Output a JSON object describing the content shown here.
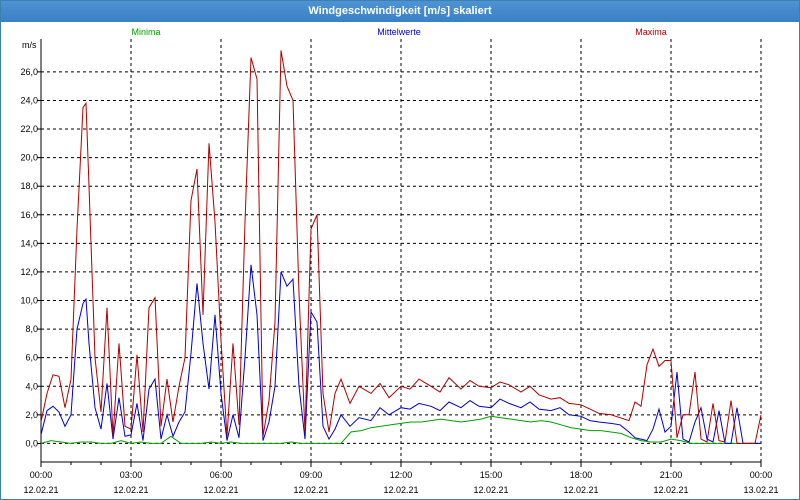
{
  "window": {
    "title": "Windgeschwindigkeit [m/s] skaliert"
  },
  "chart_data": {
    "type": "line",
    "title": "Windgeschwindigkeit [m/s] skaliert",
    "ylabel": "m/s",
    "xlabel": "",
    "ylim": [
      -1.3,
      28.3
    ],
    "xlim": [
      0,
      24
    ],
    "y_ticks": [
      0,
      2,
      4,
      6,
      8,
      10,
      12,
      14,
      16,
      18,
      20,
      22,
      24,
      26
    ],
    "y_tick_labels": [
      "0,0",
      "2,0",
      "4,0",
      "6,0",
      "8,0",
      "10,0",
      "12,0",
      "14,0",
      "16,0",
      "18,0",
      "20,0",
      "22,0",
      "24,0",
      "26,0"
    ],
    "x_ticks": [
      0,
      3,
      6,
      9,
      12,
      15,
      18,
      21,
      24
    ],
    "x_tick_time_labels": [
      "00:00",
      "03:00",
      "06:00",
      "09:00",
      "12:00",
      "15:00",
      "18:00",
      "21:00",
      "00:00"
    ],
    "x_tick_date_labels": [
      "12.02.21",
      "12.02.21",
      "12.02.21",
      "12.02.21",
      "12.02.21",
      "12.02.21",
      "12.02.21",
      "12.02.21",
      "13.02.21"
    ],
    "grid": true,
    "legend_placement": "top",
    "series": [
      {
        "name": "Minima",
        "color": "#00a000",
        "x": [
          0,
          0.33,
          0.67,
          1,
          1.33,
          1.67,
          2,
          2.33,
          2.67,
          3,
          3.33,
          3.67,
          4,
          4.33,
          4.67,
          5,
          5.33,
          5.67,
          6,
          6.33,
          6.67,
          7,
          7.33,
          7.67,
          8,
          8.33,
          8.67,
          9,
          9.33,
          9.67,
          10,
          10.33,
          10.67,
          11,
          11.33,
          11.67,
          12,
          12.33,
          12.67,
          13,
          13.33,
          13.67,
          14,
          14.33,
          14.67,
          15,
          15.33,
          15.67,
          16,
          16.33,
          16.67,
          17,
          17.33,
          17.67,
          18,
          18.33,
          18.67,
          19,
          19.33,
          19.67,
          20,
          20.33,
          20.67,
          21,
          21.33,
          21.67,
          22,
          22.33,
          22.67,
          23,
          23.33,
          23.67,
          24
        ],
        "values": [
          0,
          0.2,
          0.1,
          0,
          0.1,
          0.1,
          0,
          0,
          0.2,
          0,
          0.1,
          0,
          0,
          0.5,
          0,
          0,
          0,
          0.1,
          0,
          0.1,
          0,
          0,
          0,
          0,
          0,
          0.1,
          0,
          0,
          0,
          0,
          0,
          0.8,
          0.9,
          1.1,
          1.2,
          1.3,
          1.4,
          1.5,
          1.5,
          1.6,
          1.7,
          1.6,
          1.5,
          1.6,
          1.7,
          1.9,
          1.8,
          1.7,
          1.6,
          1.5,
          1.6,
          1.5,
          1.3,
          1.1,
          1.0,
          0.9,
          0.9,
          0.8,
          0.7,
          0.4,
          0.2,
          0.1,
          0.1,
          0.3,
          0.2,
          0,
          0,
          0,
          0,
          0,
          0,
          0,
          0
        ]
      },
      {
        "name": "Mittelwerte",
        "color": "#0000cc",
        "x": [
          0,
          0.2,
          0.4,
          0.6,
          0.8,
          1,
          1.2,
          1.4,
          1.5,
          1.6,
          1.8,
          2,
          2.2,
          2.4,
          2.6,
          2.8,
          3,
          3.2,
          3.4,
          3.6,
          3.8,
          4,
          4.2,
          4.4,
          4.6,
          4.8,
          5,
          5.2,
          5.4,
          5.6,
          5.8,
          6,
          6.2,
          6.4,
          6.6,
          6.8,
          7,
          7.2,
          7.4,
          7.6,
          7.8,
          8,
          8.2,
          8.4,
          8.6,
          8.8,
          9,
          9.2,
          9.4,
          9.6,
          9.8,
          10,
          10.3,
          10.6,
          11,
          11.3,
          11.6,
          12,
          12.3,
          12.6,
          13,
          13.3,
          13.6,
          14,
          14.3,
          14.6,
          15,
          15.3,
          15.6,
          16,
          16.3,
          16.6,
          17,
          17.3,
          17.6,
          18,
          18.3,
          18.6,
          19,
          19.3,
          19.6,
          19.8,
          20,
          20.2,
          20.4,
          20.6,
          20.8,
          21,
          21.2,
          21.4,
          21.6,
          21.8,
          22,
          22.2,
          22.4,
          22.6,
          22.8,
          23,
          23.2,
          23.4,
          23.6,
          23.8,
          24
        ],
        "values": [
          0.6,
          2.3,
          2.6,
          2.2,
          1.2,
          2.0,
          8.0,
          9.8,
          10.1,
          7.0,
          2.5,
          1.0,
          4.2,
          0.3,
          3.2,
          0.5,
          0.6,
          2.8,
          0.2,
          3.8,
          4.5,
          0.3,
          2.0,
          0.5,
          1.5,
          2.2,
          6.3,
          11.2,
          7.0,
          3.8,
          9.0,
          3.5,
          0.2,
          2.0,
          0.4,
          6.0,
          12.5,
          9.0,
          0.2,
          1.5,
          4.0,
          12.0,
          11.0,
          11.5,
          4.0,
          0.3,
          9.2,
          8.5,
          1.2,
          0.3,
          1.0,
          2.0,
          1.2,
          1.8,
          1.6,
          2.5,
          2.0,
          2.5,
          2.4,
          2.8,
          2.6,
          2.3,
          2.9,
          2.5,
          3.0,
          2.6,
          2.5,
          3.1,
          2.8,
          2.5,
          2.9,
          2.4,
          2.3,
          2.5,
          2.0,
          1.9,
          1.6,
          1.5,
          1.4,
          1.3,
          0.8,
          0.4,
          0.3,
          0.2,
          1.0,
          2.4,
          0.8,
          1.2,
          5.0,
          0.3,
          0.1,
          1.5,
          2.5,
          0.3,
          0.1,
          2.3,
          0,
          0,
          2.5,
          0,
          0,
          0,
          0
        ]
      },
      {
        "name": "Maxima",
        "color": "#b00000",
        "x": [
          0,
          0.2,
          0.4,
          0.6,
          0.8,
          1,
          1.2,
          1.4,
          1.5,
          1.6,
          1.8,
          2,
          2.2,
          2.4,
          2.6,
          2.8,
          3,
          3.2,
          3.4,
          3.6,
          3.8,
          4,
          4.2,
          4.4,
          4.6,
          4.8,
          5,
          5.2,
          5.4,
          5.6,
          5.8,
          6,
          6.2,
          6.4,
          6.6,
          6.8,
          7,
          7.2,
          7.4,
          7.6,
          7.8,
          8,
          8.2,
          8.4,
          8.6,
          8.8,
          9,
          9.2,
          9.4,
          9.6,
          9.8,
          10,
          10.3,
          10.6,
          11,
          11.3,
          11.6,
          12,
          12.3,
          12.6,
          13,
          13.3,
          13.6,
          14,
          14.3,
          14.6,
          15,
          15.3,
          15.6,
          16,
          16.3,
          16.6,
          17,
          17.3,
          17.6,
          18,
          18.3,
          18.6,
          19,
          19.3,
          19.6,
          19.8,
          20,
          20.2,
          20.4,
          20.6,
          20.8,
          21,
          21.2,
          21.4,
          21.6,
          21.8,
          22,
          22.2,
          22.4,
          22.6,
          22.8,
          23,
          23.2,
          23.4,
          23.6,
          23.8,
          24
        ],
        "values": [
          1.5,
          3.5,
          4.8,
          4.7,
          2.5,
          4.5,
          15.0,
          23.5,
          23.8,
          18.0,
          6.0,
          2.2,
          9.5,
          0.5,
          7.0,
          1.2,
          1.0,
          6.2,
          0.8,
          9.5,
          10.2,
          1.2,
          4.5,
          1.5,
          4.0,
          6.0,
          17.0,
          19.2,
          9.0,
          21.0,
          15.5,
          7.2,
          0.5,
          7.0,
          1.3,
          15.5,
          27.0,
          25.5,
          0.5,
          3.0,
          8.5,
          27.5,
          25.0,
          24.0,
          10.5,
          0.8,
          15.0,
          16.0,
          3.5,
          0.8,
          3.5,
          4.5,
          2.8,
          4.0,
          3.5,
          4.2,
          3.2,
          4.0,
          3.8,
          4.5,
          4.0,
          3.6,
          4.6,
          3.8,
          4.4,
          4.0,
          3.9,
          4.3,
          4.1,
          3.6,
          4.0,
          3.4,
          3.1,
          3.2,
          2.8,
          2.7,
          2.4,
          2.1,
          2.0,
          1.8,
          1.6,
          2.9,
          2.6,
          5.5,
          6.6,
          5.4,
          5.8,
          5.8,
          0.4,
          2.0,
          2.0,
          5.0,
          0.3,
          0.1,
          2.8,
          0.2,
          0.1,
          3.0,
          0,
          0,
          0,
          0,
          2.0
        ]
      }
    ]
  }
}
